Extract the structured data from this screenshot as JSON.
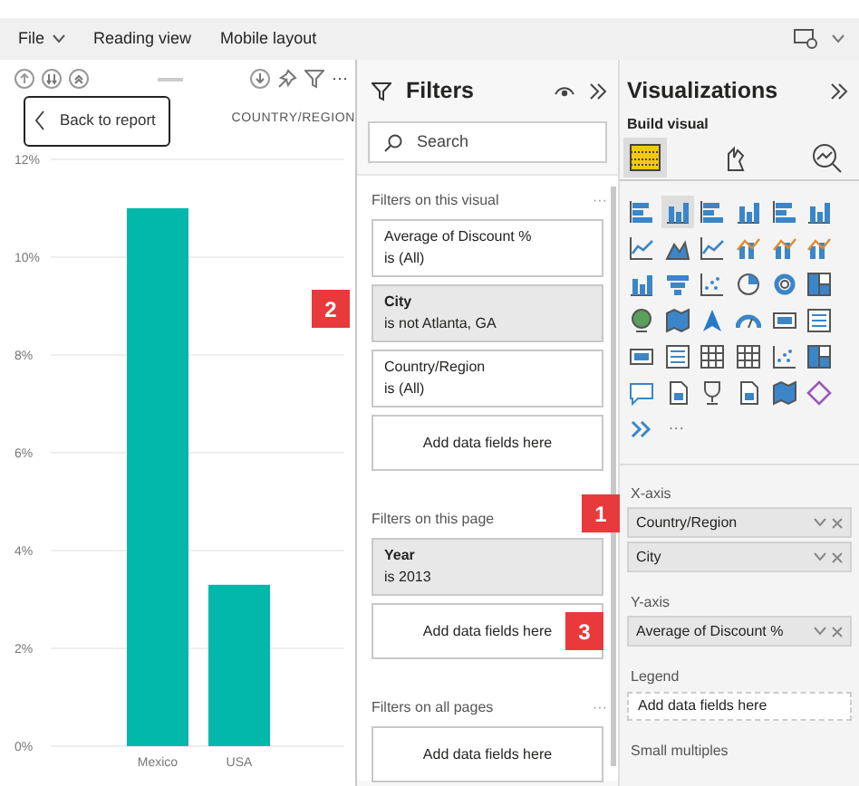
{
  "menu": [
    {
      "label": "File",
      "caret": true
    },
    {
      "label": "Reading view",
      "caret": false
    },
    {
      "label": "Mobile layout",
      "caret": false
    }
  ],
  "visual": {
    "more": "···",
    "back_button": "Back to report",
    "axis_title": "COUNTRY/REGION",
    "chart_data": {
      "type": "bar",
      "grid": true,
      "categories": [
        "Mexico",
        "USA"
      ],
      "series": [
        {
          "color": "#01b8aa",
          "values": [
            11.0,
            3.3
          ]
        }
      ],
      "ylim": [
        0,
        12
      ],
      "yticks": [
        {
          "value": 0,
          "label": "0%"
        },
        {
          "value": 2,
          "label": "2%"
        },
        {
          "value": 4,
          "label": "4%"
        },
        {
          "value": 6,
          "label": "6%"
        },
        {
          "value": 8,
          "label": "8%"
        },
        {
          "value": 10,
          "label": "10%"
        },
        {
          "value": 12,
          "label": "12%"
        }
      ]
    }
  },
  "filters": {
    "title": "Filters",
    "search_placeholder": "Search",
    "sections": [
      {
        "title": "Filters on this visual",
        "more": "···",
        "cards": [
          {
            "kind": "filter",
            "field": "Average of Discount %",
            "condition": "is (All)",
            "applied": false
          },
          {
            "kind": "filter",
            "field": "City",
            "condition": "is not Atlanta, GA",
            "applied": true,
            "callout": "2"
          },
          {
            "kind": "filter",
            "field": "Country/Region",
            "condition": "is (All)",
            "applied": false
          },
          {
            "kind": "add",
            "label": "Add data fields here"
          }
        ]
      },
      {
        "title": "Filters on this page",
        "callout": "1",
        "cards": [
          {
            "kind": "filter",
            "field": "Year",
            "condition": "is 2013",
            "applied": true
          },
          {
            "kind": "add",
            "label": "Add data fields here",
            "callout": "3"
          }
        ]
      },
      {
        "title": "Filters on all pages",
        "more": "···",
        "cards": [
          {
            "kind": "add",
            "label": "Add data fields here"
          }
        ]
      }
    ]
  },
  "visualizations": {
    "title": "Visualizations",
    "subtitle": "Build visual",
    "modes": [
      {
        "kind": "build",
        "selected": true
      },
      {
        "kind": "format",
        "selected": false
      },
      {
        "kind": "analytics",
        "selected": false
      }
    ],
    "types": [
      {
        "kind": "hbar",
        "selected": false
      },
      {
        "kind": "vbar",
        "selected": true
      },
      {
        "kind": "hbar",
        "selected": false
      },
      {
        "kind": "vbar",
        "selected": false
      },
      {
        "kind": "hbar",
        "selected": false
      },
      {
        "kind": "vbar",
        "selected": false
      },
      {
        "kind": "line",
        "selected": false
      },
      {
        "kind": "area",
        "selected": false
      },
      {
        "kind": "line",
        "selected": false
      },
      {
        "kind": "combo",
        "selected": false
      },
      {
        "kind": "combo",
        "selected": false
      },
      {
        "kind": "combo",
        "selected": false
      },
      {
        "kind": "vbar",
        "selected": false
      },
      {
        "kind": "funnel",
        "selected": false
      },
      {
        "kind": "scatter",
        "selected": false
      },
      {
        "kind": "pie",
        "selected": false
      },
      {
        "kind": "donut",
        "selected": false
      },
      {
        "kind": "tree",
        "selected": false
      },
      {
        "kind": "globe",
        "selected": false
      },
      {
        "kind": "map",
        "selected": false
      },
      {
        "kind": "arrow",
        "selected": false
      },
      {
        "kind": "gauge",
        "selected": false
      },
      {
        "kind": "card",
        "selected": false
      },
      {
        "kind": "list",
        "selected": false
      },
      {
        "kind": "card",
        "selected": false
      },
      {
        "kind": "list",
        "selected": false
      },
      {
        "kind": "table",
        "selected": false
      },
      {
        "kind": "table",
        "selected": false
      },
      {
        "kind": "scatter",
        "selected": false
      },
      {
        "kind": "tree",
        "selected": false
      },
      {
        "kind": "bubble",
        "selected": false
      },
      {
        "kind": "doc",
        "selected": false
      },
      {
        "kind": "trophy",
        "selected": false
      },
      {
        "kind": "doc",
        "selected": false
      },
      {
        "kind": "map",
        "selected": false
      },
      {
        "kind": "diamond",
        "selected": false
      },
      {
        "kind": "chevrons",
        "selected": false
      }
    ],
    "more": "···",
    "wells": [
      {
        "title": "X-axis",
        "fields": [
          "Country/Region",
          "City"
        ]
      },
      {
        "title": "Y-axis",
        "fields": [
          "Average of Discount %"
        ]
      },
      {
        "title": "Legend",
        "placeholder": "Add data fields here"
      },
      {
        "title": "Small multiples"
      }
    ]
  }
}
